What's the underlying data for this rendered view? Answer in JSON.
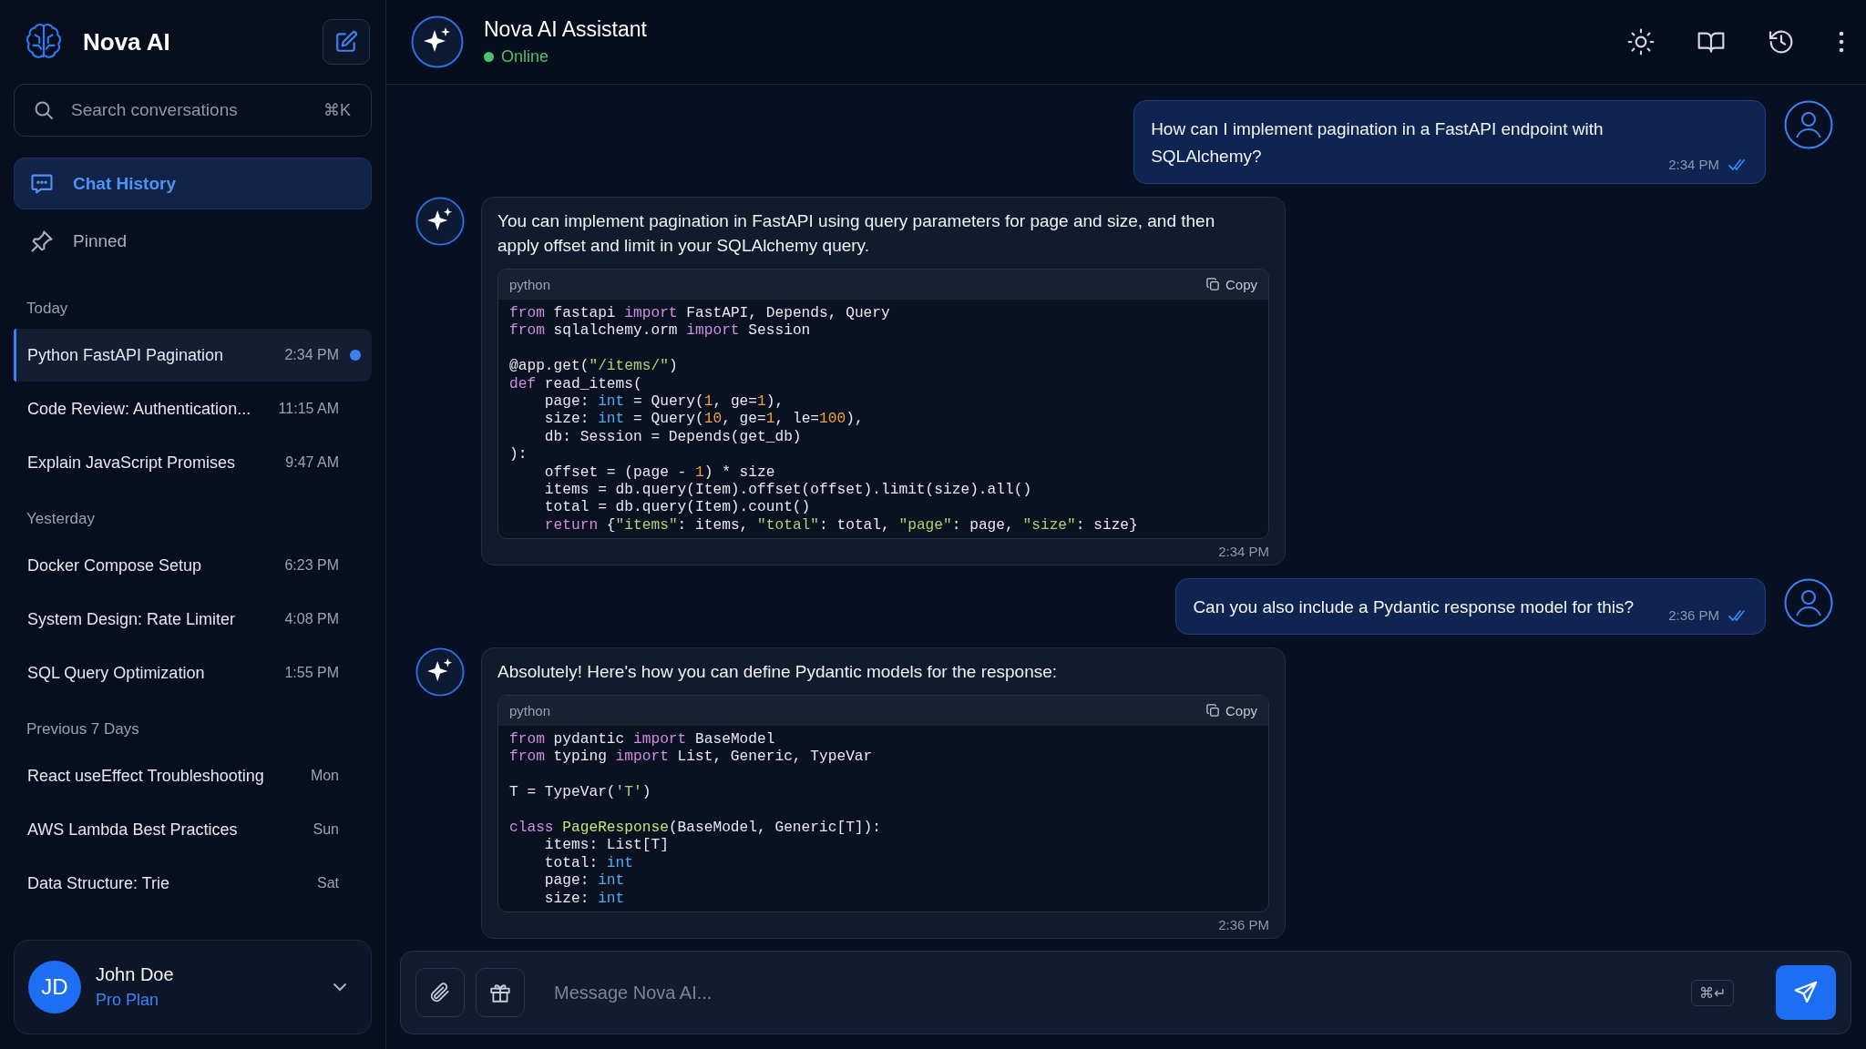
{
  "app": {
    "name": "Nova AI"
  },
  "search": {
    "placeholder": "Search conversations",
    "shortcut": "⌘K"
  },
  "nav": [
    {
      "label": "Chat History",
      "selected": true
    },
    {
      "label": "Pinned",
      "selected": false
    }
  ],
  "groups": [
    {
      "label": "Today",
      "items": [
        {
          "title": "Python FastAPI Pagination",
          "time": "2:34 PM",
          "selected": true,
          "unread": true
        },
        {
          "title": "Code Review: Authentication...",
          "time": "11:15 AM",
          "selected": false,
          "unread": false
        },
        {
          "title": "Explain JavaScript Promises",
          "time": "9:47 AM",
          "selected": false,
          "unread": false
        }
      ]
    },
    {
      "label": "Yesterday",
      "items": [
        {
          "title": "Docker Compose Setup",
          "time": "6:23 PM",
          "selected": false,
          "unread": false
        },
        {
          "title": "System Design: Rate Limiter",
          "time": "4:08 PM",
          "selected": false,
          "unread": false
        },
        {
          "title": "SQL Query Optimization",
          "time": "1:55 PM",
          "selected": false,
          "unread": false
        }
      ]
    },
    {
      "label": "Previous 7 Days",
      "items": [
        {
          "title": "React useEffect Troubleshooting",
          "time": "Mon",
          "selected": false,
          "unread": false
        },
        {
          "title": "AWS Lambda Best Practices",
          "time": "Sun",
          "selected": false,
          "unread": false
        },
        {
          "title": "Data Structure: Trie",
          "time": "Sat",
          "selected": false,
          "unread": false
        }
      ]
    }
  ],
  "user": {
    "initials": "JD",
    "name": "John Doe",
    "plan": "Pro Plan"
  },
  "header": {
    "title": "Nova AI Assistant",
    "status": "Online",
    "online": true
  },
  "messages": [
    {
      "kind": "user",
      "text": "How can I implement pagination in a FastAPI endpoint with SQLAlchemy?",
      "time": "2:34 PM",
      "read": true
    },
    {
      "kind": "assistant",
      "text": "You can implement pagination in FastAPI using query parameters for page and size, and then apply offset and limit in your SQLAlchemy query.",
      "time": "2:34 PM",
      "code": {
        "language": "python",
        "copy_label": "Copy",
        "lines": [
          {
            "kind": "code",
            "tokens": [
              {
                "kind": "kw",
                "t": "from"
              },
              {
                "kind": "plain",
                "t": " fastapi "
              },
              {
                "kind": "kw",
                "t": "import"
              },
              {
                "kind": "plain",
                "t": " FastAPI, Depends, Query"
              }
            ]
          },
          {
            "kind": "code",
            "tokens": [
              {
                "kind": "kw",
                "t": "from"
              },
              {
                "kind": "plain",
                "t": " sqlalchemy.orm "
              },
              {
                "kind": "kw",
                "t": "import"
              },
              {
                "kind": "plain",
                "t": " Session"
              }
            ]
          },
          {
            "kind": "blank"
          },
          {
            "kind": "code",
            "tokens": [
              {
                "kind": "plain",
                "t": "@app.get("
              },
              {
                "kind": "str",
                "t": "\"/items/\""
              },
              {
                "kind": "plain",
                "t": ")"
              }
            ]
          },
          {
            "kind": "code",
            "tokens": [
              {
                "kind": "kw",
                "t": "def"
              },
              {
                "kind": "plain",
                "t": " read_items("
              }
            ]
          },
          {
            "kind": "code",
            "tokens": [
              {
                "kind": "plain",
                "t": "    page: "
              },
              {
                "kind": "type",
                "t": "int"
              },
              {
                "kind": "plain",
                "t": " = Query("
              },
              {
                "kind": "num",
                "t": "1"
              },
              {
                "kind": "plain",
                "t": ", ge="
              },
              {
                "kind": "num",
                "t": "1"
              },
              {
                "kind": "plain",
                "t": "),"
              }
            ]
          },
          {
            "kind": "code",
            "tokens": [
              {
                "kind": "plain",
                "t": "    size: "
              },
              {
                "kind": "type",
                "t": "int"
              },
              {
                "kind": "plain",
                "t": " = Query("
              },
              {
                "kind": "num",
                "t": "10"
              },
              {
                "kind": "plain",
                "t": ", ge="
              },
              {
                "kind": "num",
                "t": "1"
              },
              {
                "kind": "plain",
                "t": ", le="
              },
              {
                "kind": "num",
                "t": "100"
              },
              {
                "kind": "plain",
                "t": "),"
              }
            ]
          },
          {
            "kind": "code",
            "tokens": [
              {
                "kind": "plain",
                "t": "    db: Session = Depends(get_db)"
              }
            ]
          },
          {
            "kind": "code",
            "tokens": [
              {
                "kind": "plain",
                "t": "):"
              }
            ]
          },
          {
            "kind": "code",
            "tokens": [
              {
                "kind": "plain",
                "t": "    offset = (page - "
              },
              {
                "kind": "num",
                "t": "1"
              },
              {
                "kind": "plain",
                "t": ") * size"
              }
            ]
          },
          {
            "kind": "code",
            "tokens": [
              {
                "kind": "plain",
                "t": "    items = db.query(Item).offset(offset).limit(size).all()"
              }
            ]
          },
          {
            "kind": "code",
            "tokens": [
              {
                "kind": "plain",
                "t": "    total = db.query(Item).count()"
              }
            ]
          },
          {
            "kind": "code",
            "tokens": [
              {
                "kind": "kw",
                "t": "    return"
              },
              {
                "kind": "plain",
                "t": " {"
              },
              {
                "kind": "str",
                "t": "\"items\""
              },
              {
                "kind": "plain",
                "t": ": items, "
              },
              {
                "kind": "str",
                "t": "\"total\""
              },
              {
                "kind": "plain",
                "t": ": total, "
              },
              {
                "kind": "str",
                "t": "\"page\""
              },
              {
                "kind": "plain",
                "t": ": page, "
              },
              {
                "kind": "str",
                "t": "\"size\""
              },
              {
                "kind": "plain",
                "t": ": size}"
              }
            ]
          }
        ]
      }
    },
    {
      "kind": "user",
      "text": "Can you also include a Pydantic response model for this?",
      "time": "2:36 PM",
      "read": true
    },
    {
      "kind": "assistant",
      "text": "Absolutely! Here's how you can define Pydantic models for the response:",
      "time": "2:36 PM",
      "code": {
        "language": "python",
        "copy_label": "Copy",
        "lines": [
          {
            "kind": "code",
            "tokens": [
              {
                "kind": "kw",
                "t": "from"
              },
              {
                "kind": "plain",
                "t": " pydantic "
              },
              {
                "kind": "kw",
                "t": "import"
              },
              {
                "kind": "plain",
                "t": " BaseModel"
              }
            ]
          },
          {
            "kind": "code",
            "tokens": [
              {
                "kind": "kw",
                "t": "from"
              },
              {
                "kind": "plain",
                "t": " typing "
              },
              {
                "kind": "kw",
                "t": "import"
              },
              {
                "kind": "plain",
                "t": " List, Generic, TypeVar"
              }
            ]
          },
          {
            "kind": "blank"
          },
          {
            "kind": "code",
            "tokens": [
              {
                "kind": "plain",
                "t": "T = TypeVar("
              },
              {
                "kind": "str",
                "t": "'T'"
              },
              {
                "kind": "plain",
                "t": ")"
              }
            ]
          },
          {
            "kind": "blank"
          },
          {
            "kind": "code",
            "tokens": [
              {
                "kind": "kw",
                "t": "class "
              },
              {
                "kind": "cls",
                "t": "PageResponse"
              },
              {
                "kind": "plain",
                "t": "(BaseModel, Generic[T]):"
              }
            ]
          },
          {
            "kind": "code",
            "tokens": [
              {
                "kind": "plain",
                "t": "    items: List[T]"
              }
            ]
          },
          {
            "kind": "code",
            "tokens": [
              {
                "kind": "plain",
                "t": "    total: "
              },
              {
                "kind": "type",
                "t": "int"
              }
            ]
          },
          {
            "kind": "code",
            "tokens": [
              {
                "kind": "plain",
                "t": "    page: "
              },
              {
                "kind": "type",
                "t": "int"
              }
            ]
          },
          {
            "kind": "code",
            "tokens": [
              {
                "kind": "plain",
                "t": "    size: "
              },
              {
                "kind": "type",
                "t": "int"
              }
            ]
          }
        ]
      }
    }
  ],
  "composer": {
    "placeholder": "Message Nova AI...",
    "shortcut": "⌘↵"
  }
}
